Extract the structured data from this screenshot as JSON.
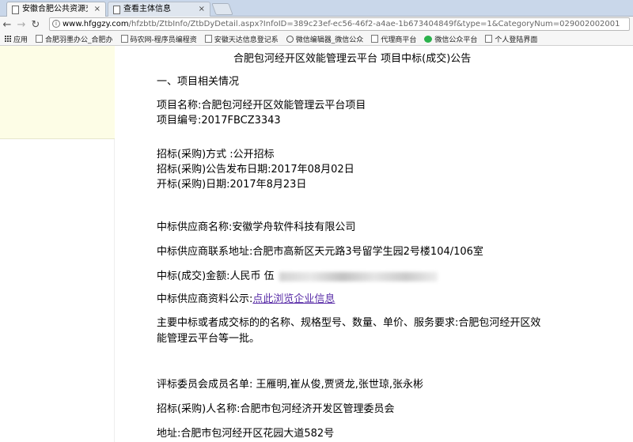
{
  "browser": {
    "tabs": [
      {
        "label": "安徽合肥公共资源交易中"
      },
      {
        "label": "查看主体信息"
      }
    ],
    "close_glyph": "×",
    "url": {
      "host": "www.hfggzy.com",
      "path": "/hfzbtb/ZtbInfo/ZtbDyDetail.aspx?InfoID=389c23ef-ec56-46f2-a4ae-1b673404849f&type=1&CategoryNum=029002002001"
    },
    "bookmarks": [
      {
        "label": "应用",
        "icon": "apps-icon"
      },
      {
        "label": "合肥羽墨办公_合肥办",
        "icon": "page-icon"
      },
      {
        "label": "码农网-程序员编程资",
        "icon": "page-icon"
      },
      {
        "label": "安徽天达信息登记系",
        "icon": "page-icon"
      },
      {
        "label": "微信编辑器_微信公众",
        "icon": "circle-icon"
      },
      {
        "label": "代理商平台",
        "icon": "page-icon"
      },
      {
        "label": "微信公众平台",
        "icon": "wechat-icon"
      },
      {
        "label": "个人登陆界面",
        "icon": "page-icon"
      }
    ]
  },
  "notice": {
    "title": "合肥包河经开区效能管理云平台 项目中标(成交)公告",
    "section1": "一、项目相关情况",
    "project_name": "项目名称:合肥包河经开区效能管理云平台项目",
    "project_no": "项目编号:2017FBCZ3343",
    "method": "招标(采购)方式 :公开招标",
    "publish_date": "招标(采购)公告发布日期:2017年08月02日",
    "open_date": "开标(采购)日期:2017年8月23日",
    "supplier_name": "中标供应商名称:安徽学舟软件科技有限公司",
    "supplier_address": "中标供应商联系地址:合肥市高新区天元路3号留学生园2号楼104/106室",
    "amount_label": "中标(成交)金额:人民币 伍",
    "publicity_label": "中标供应商资料公示:",
    "publicity_link": "点此浏览企业信息",
    "requirement_line1": "主要中标或者成交标的的名称、规格型号、数量、单价、服务要求:合肥包河经开区效",
    "requirement_line2": "能管理云平台等一批。",
    "committee": "评标委员会成员名单: 王雁明,崔从俊,贾贤龙,张世琼,张永彬",
    "purchaser": "招标(采购)人名称:合肥市包河经济开发区管理委员会",
    "purchaser_address": "地址:合肥市包河经开区花园大道582号"
  }
}
